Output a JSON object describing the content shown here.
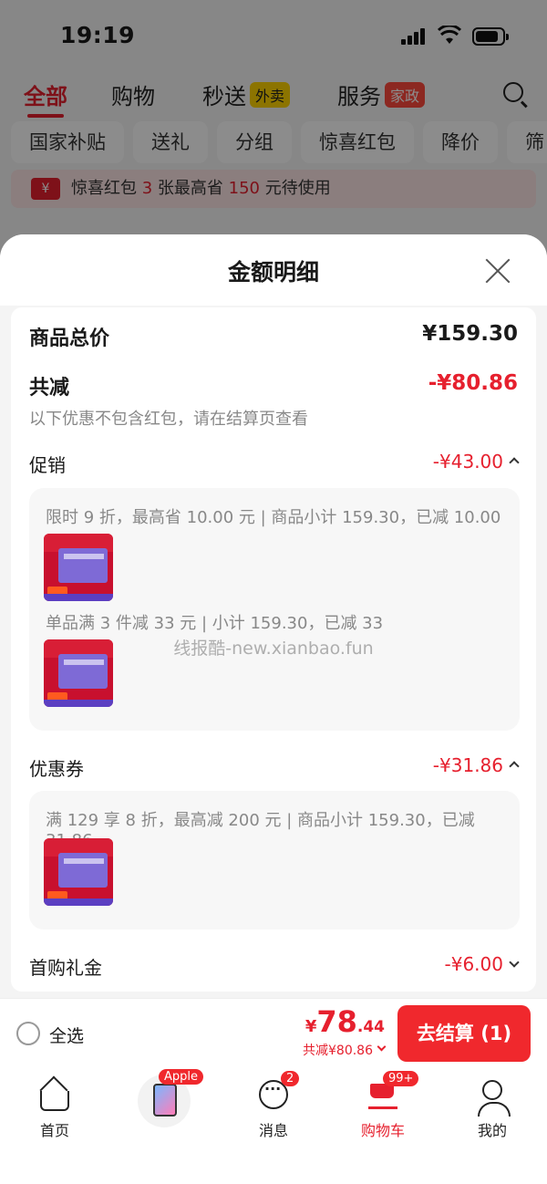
{
  "status_bar": {
    "time": "19:19"
  },
  "top_tabs": {
    "all": "全部",
    "shopping": "购物",
    "flash": "秒送",
    "flash_tag": "外卖",
    "service": "服务",
    "service_tag": "家政"
  },
  "chips": [
    "国家补贴",
    "送礼",
    "分组",
    "惊喜红包",
    "降价",
    "筛"
  ],
  "promo_strip": {
    "pre": "惊喜红包",
    "count": "3",
    "mid": "张最高省",
    "amount": "150",
    "post": "元待使用",
    "icon": "¥"
  },
  "sheet": {
    "title": "金额明细",
    "goods_total_label": "商品总价",
    "goods_total_value": "¥159.30",
    "reduction_label": "共减",
    "reduction_value": "-¥80.86",
    "note": "以下优惠不包含红包，请在结算页查看",
    "promotion_label": "促销",
    "promotion_value": "-¥43.00",
    "promo_lines": [
      "限时 9 折，最高省 10.00 元 | 商品小计 159.30，已减 10.00",
      "单品满 3 件减 33 元 | 小计 159.30，已减 33"
    ],
    "coupon_label": "优惠券",
    "coupon_value": "-¥31.86",
    "coupon_line": "满 129 享 8 折，最高减 200 元 | 商品小计 159.30，已减 31.86",
    "first_gift_label": "首购礼金",
    "first_gift_value": "-¥6.00"
  },
  "watermark": "线报酷-new.xianbao.fun",
  "cart_bar": {
    "select_all": "全选",
    "price_symbol": "¥",
    "price_int": "78",
    "price_dec": ".44",
    "total_reduction": "共减¥80.86",
    "checkout": "去结算 (1)"
  },
  "tabbar": {
    "home": "首页",
    "apple_badge": "Apple",
    "messages": "消息",
    "messages_badge": "2",
    "cart": "购物车",
    "cart_badge": "99+",
    "me": "我的"
  },
  "colors": {
    "accent": "#e6202e",
    "checkout": "#f0282d"
  }
}
